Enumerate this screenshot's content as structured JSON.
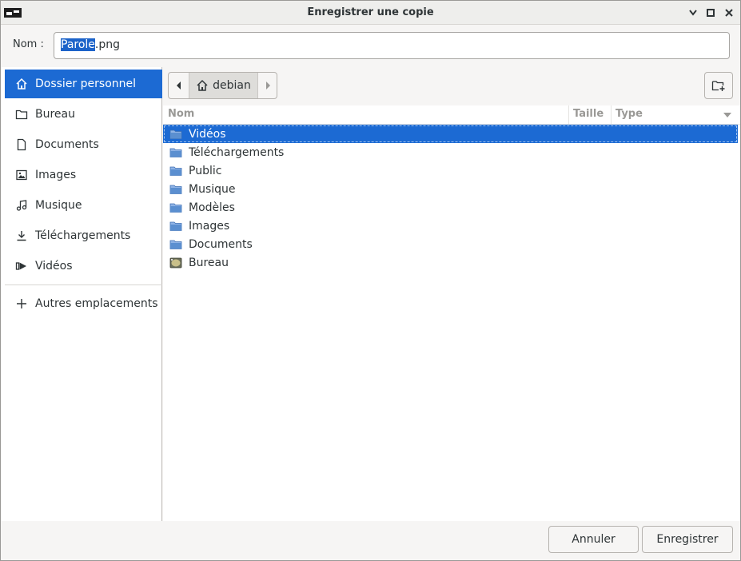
{
  "window": {
    "title": "Enregistrer une copie"
  },
  "name_row": {
    "label": "Nom :",
    "value_selected": "Parole",
    "value_rest": ".png"
  },
  "sidebar": {
    "items": [
      {
        "label": "Dossier personnel",
        "icon": "home-icon",
        "active": true
      },
      {
        "label": "Bureau",
        "icon": "folder-icon"
      },
      {
        "label": "Documents",
        "icon": "document-icon"
      },
      {
        "label": "Images",
        "icon": "image-icon"
      },
      {
        "label": "Musique",
        "icon": "music-icon"
      },
      {
        "label": "Téléchargements",
        "icon": "download-icon"
      },
      {
        "label": "Vidéos",
        "icon": "video-icon"
      }
    ],
    "other_locations": "Autres emplacements"
  },
  "path_bar": {
    "current": "debian"
  },
  "columns": {
    "name": "Nom",
    "size": "Taille",
    "type": "Type"
  },
  "files": [
    {
      "name": "Vidéos",
      "selected": true
    },
    {
      "name": "Téléchargements"
    },
    {
      "name": "Public"
    },
    {
      "name": "Musique"
    },
    {
      "name": "Modèles"
    },
    {
      "name": "Images"
    },
    {
      "name": "Documents"
    },
    {
      "name": "Bureau",
      "icon": "desktop-icon"
    }
  ],
  "buttons": {
    "cancel": "Annuler",
    "save": "Enregistrer"
  },
  "colors": {
    "accent": "#1c6ad3",
    "folder": "#5b8fd0"
  }
}
